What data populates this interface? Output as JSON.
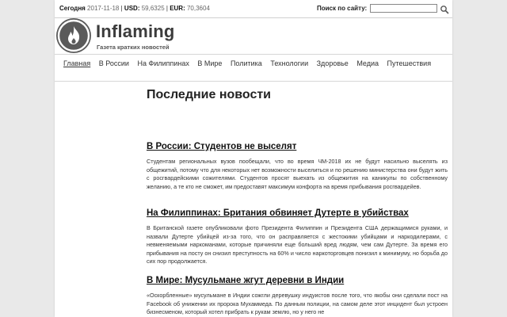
{
  "topbar": {
    "today_label": "Сегодня",
    "date": "2017-11-18",
    "usd_label": "USD:",
    "usd_value": "59,6325",
    "eur_label": "EUR:",
    "eur_value": "70,3604",
    "search_label": "Поиск по сайту:",
    "search_value": ""
  },
  "header": {
    "title": "Inflaming",
    "tagline": "Газета кратких новостей",
    "logo_icon": "flame-icon"
  },
  "nav": {
    "items": [
      {
        "label": "Главная",
        "active": true
      },
      {
        "label": "В России"
      },
      {
        "label": "На Филиппинах"
      },
      {
        "label": "В Мире"
      },
      {
        "label": "Политика"
      },
      {
        "label": "Технологии"
      },
      {
        "label": "Здоровье"
      },
      {
        "label": "Медиа"
      },
      {
        "label": "Путешествия"
      }
    ]
  },
  "main": {
    "heading": "Последние новости",
    "articles": [
      {
        "title": "В России: Студентов не выселят",
        "text": "Студентам региональных вузов пообещали, что во время ЧМ-2018 их не будут насильно выселять из общежитий, потому что для некоторых нет возможности выселиться и по решению министерства они будут жить с росгвардейскими сожителями. Студентов просят выехать из общежития на каникулы по собственному желанию, а те кто не сможет, им предоставят максимум конфорта на время прибывания росгвардейев."
      },
      {
        "title": "На Филиппинах: Британия обвиняет Дутерте в убийствах",
        "text": "В Британской газете опубликовали фото Президента Филиппин и Президента США держащимися руками, и назвали Дутерте убийцей из-за того, что он расправляется с жестокими убийцами и наркодилерами, с невменяемыми наркоманами, которые причиняли еще больший вред людям, чем сам Дутерте. За время его прибывания на посту он снизил преступность на 60% и число наркоторговцев понизил к минимуму, но борьба до сих пор продолжается."
      },
      {
        "title": "В Мире: Мусульмане жгут деревни в Индии",
        "text": "«Оскорбленные» мусульмане в Индии сожгли деревушку индуистов после того, что якобы они сделали пост на Facebook об унижении их пророка Мухаммеда. По данным полиции, на самом деле этот инцидент был устроен бизнесменом, который хотел прибрать к рукам землю, но у него не"
      }
    ]
  }
}
